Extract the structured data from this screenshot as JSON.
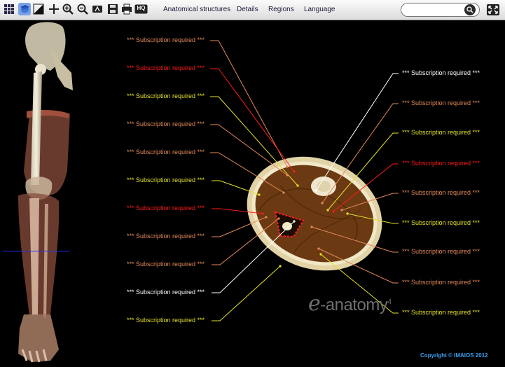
{
  "toolbar": {
    "tools": [
      {
        "name": "grid-icon"
      },
      {
        "name": "layers-icon"
      },
      {
        "name": "contrast-icon"
      },
      {
        "name": "move-icon"
      },
      {
        "name": "zoom-in-icon"
      },
      {
        "name": "zoom-out-icon"
      },
      {
        "name": "annotation-icon"
      },
      {
        "name": "save-icon"
      },
      {
        "name": "print-icon"
      },
      {
        "name": "hq-icon",
        "label": "HQ"
      }
    ],
    "menu": [
      "Anatomical structures",
      "Details",
      "Regions",
      "Language"
    ],
    "search_placeholder": "",
    "search_icon": "magnifier-icon",
    "fullscreen_icon": "fullscreen-icon"
  },
  "colors": {
    "orange": "#e38a5a",
    "red": "#ff1c1c",
    "yellow": "#e4e22c",
    "white": "#ffffff",
    "navigator_line": "#1e2fff",
    "copyright": "#3aa0f0"
  },
  "labels_left": [
    {
      "text": "*** Subscription required ***",
      "color": "orange"
    },
    {
      "text": "*** Subscription required ***",
      "color": "red"
    },
    {
      "text": "*** Subscription required ***",
      "color": "yellow"
    },
    {
      "text": "*** Subscription required ***",
      "color": "orange"
    },
    {
      "text": "*** Subscription required ***",
      "color": "orange"
    },
    {
      "text": "*** Subscription required ***",
      "color": "yellow"
    },
    {
      "text": "*** Subscription required ***",
      "color": "red"
    },
    {
      "text": "*** Subscription required ***",
      "color": "orange"
    },
    {
      "text": "*** Subscription required ***",
      "color": "orange"
    },
    {
      "text": "*** Subscription required ***",
      "color": "white"
    },
    {
      "text": "*** Subscription required ***",
      "color": "yellow"
    }
  ],
  "labels_right": [
    {
      "text": "*** Subscription required ***",
      "color": "white"
    },
    {
      "text": "*** Subscription required ***",
      "color": "orange"
    },
    {
      "text": "*** Subscription required ***",
      "color": "yellow"
    },
    {
      "text": "*** Subscription required ***",
      "color": "red"
    },
    {
      "text": "*** Subscription required ***",
      "color": "orange"
    },
    {
      "text": "*** Subscription required ***",
      "color": "yellow"
    },
    {
      "text": "*** Subscription required ***",
      "color": "orange"
    },
    {
      "text": "*** Subscription required ***",
      "color": "orange"
    },
    {
      "text": "*** Subscription required ***",
      "color": "yellow"
    }
  ],
  "watermark": {
    "glyph": "e",
    "text": "-anatomy",
    "sup": "4"
  },
  "copyright": "Copyright © IMAIOS 2012"
}
